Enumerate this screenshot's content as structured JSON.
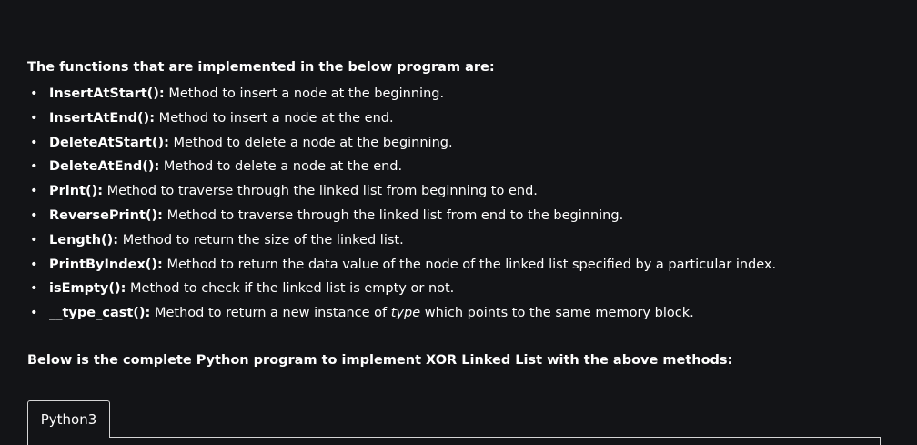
{
  "intro": "The functions that are implemented in the below program are:",
  "functions": [
    {
      "name": "InsertAtStart():",
      "desc": " Method to insert a node at the beginning."
    },
    {
      "name": "InsertAtEnd():",
      "desc": " Method to insert a node at the end."
    },
    {
      "name": "DeleteAtStart():",
      "desc": " Method to delete a node at the beginning."
    },
    {
      "name": "DeleteAtEnd():",
      "desc": " Method to delete a node at the end."
    },
    {
      "name": "Print():",
      "desc": " Method to traverse through the linked list from beginning to end."
    },
    {
      "name": "ReversePrint():",
      "desc": " Method to traverse through the linked list from end to the beginning."
    },
    {
      "name": "Length():",
      "desc": " Method to return the size of the linked list."
    },
    {
      "name": "PrintByIndex():",
      "desc": " Method to return the data value of the node of the linked list specified by a particular index."
    },
    {
      "name": "isEmpty():",
      "desc": " Method to check if the linked list is empty or not."
    },
    {
      "name": "__type_cast():",
      "desc": " Method to return a new instance of ",
      "italic": "type",
      "desc_after": " which points to the same memory block."
    }
  ],
  "outro": "Below is the complete Python program to implement XOR Linked List with the above methods:",
  "code_tab": {
    "label": "Python3"
  },
  "bullet_char": "•"
}
